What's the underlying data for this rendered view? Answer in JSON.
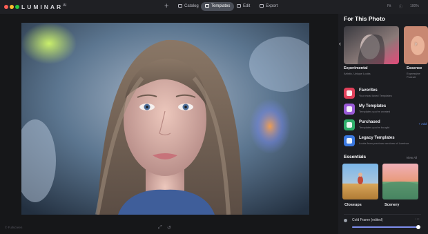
{
  "app": {
    "name": "LUMINAR",
    "version": "AI"
  },
  "nav": {
    "add_label": "+",
    "catalog": "Catalog",
    "templates": "Templates",
    "edit": "Edit",
    "export": "Export"
  },
  "topbar_right": {
    "zoom": "Fit",
    "info": "100%"
  },
  "panel": {
    "title": "For This Photo",
    "cards": [
      {
        "name": "Experimental",
        "sub": "Artistic, Unique Looks"
      },
      {
        "name": "Essence",
        "sub": "Expressive Portrait"
      }
    ],
    "rows": [
      {
        "title": "Favorites",
        "sub": "Your most loved Templates",
        "color": "#e0405a"
      },
      {
        "title": "My Templates",
        "sub": "Templates you've created",
        "color": "#9a5ad8"
      },
      {
        "title": "Purchased",
        "sub": "Templates you've bought",
        "color": "#2fae6a",
        "action": "+ Add"
      },
      {
        "title": "Legacy Templates",
        "sub": "Looks from previous versions of Luminar",
        "color": "#3a78e0"
      }
    ],
    "essentials_title": "Essentials",
    "essentials_link": "View All",
    "essentials": [
      {
        "name": "Closeups"
      },
      {
        "name": "Scenery"
      }
    ],
    "slider": {
      "label": "Cold Frame (edited)",
      "more": "···",
      "value_percent": 100
    }
  },
  "footer": {
    "left": "© Fullscreen"
  }
}
